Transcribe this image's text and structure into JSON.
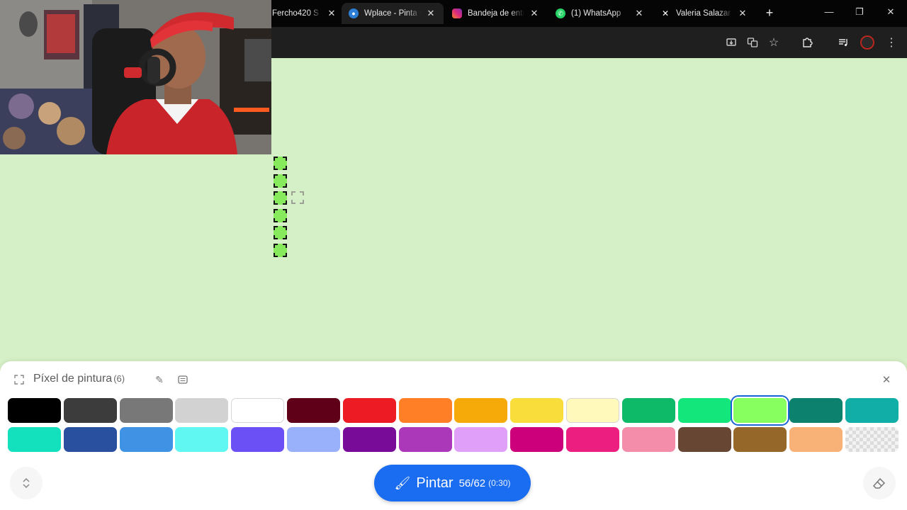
{
  "browser": {
    "tabs": [
      {
        "label": "Fercho420 S",
        "icon": "tab-favicon",
        "active": false
      },
      {
        "label": "Wplace - Pinta el mundo",
        "icon": "globe-icon",
        "active": true
      },
      {
        "label": "Bandeja de entrada",
        "icon": "instagram-icon",
        "active": false
      },
      {
        "label": "(1) WhatsApp",
        "icon": "whatsapp-icon",
        "active": false
      },
      {
        "label": "Valeria Salazar (@",
        "icon": "x-logo-icon",
        "active": false
      }
    ],
    "new_tab": "+",
    "window_controls": {
      "minimize": "—",
      "restore": "❐",
      "close": "✕"
    },
    "toolbar_icons": [
      "install-icon",
      "translate-icon",
      "star-icon",
      "extensions-icon",
      "media-icon",
      "profile-icon",
      "menu-icon"
    ]
  },
  "canvas": {
    "paint_color": "#87e95c",
    "pixel_count": 6
  },
  "panel": {
    "title": "Píxel de pintura",
    "count": "(6)",
    "palette": [
      "#000000",
      "#3c3c3c",
      "#787878",
      "#d2d2d2",
      "#ffffff",
      "#600018",
      "#ed1c24",
      "#ff7f27",
      "#f6aa09",
      "#f9dd3b",
      "#fffabc",
      "#0eb968",
      "#13e67b",
      "#87ff5e",
      "#0c816e",
      "#10aea6",
      "#13e1be",
      "#28509e",
      "#4093e4",
      "#60f7f2",
      "#6b50f6",
      "#99b1fb",
      "#780c99",
      "#aa38b9",
      "#e09ff9",
      "#cb007a",
      "#ec1f80",
      "#f38da9",
      "#684634",
      "#95682a",
      "#f8b277",
      "transparent"
    ],
    "selected_color": "#87ff5e",
    "paint_button": {
      "label": "Pintar",
      "count": "56/62",
      "timer": "(0:30)"
    }
  },
  "colors": {
    "accent": "#1a6cf0",
    "canvas_bg": "#d5efc6",
    "chrome_bg": "#1f1f1f"
  }
}
